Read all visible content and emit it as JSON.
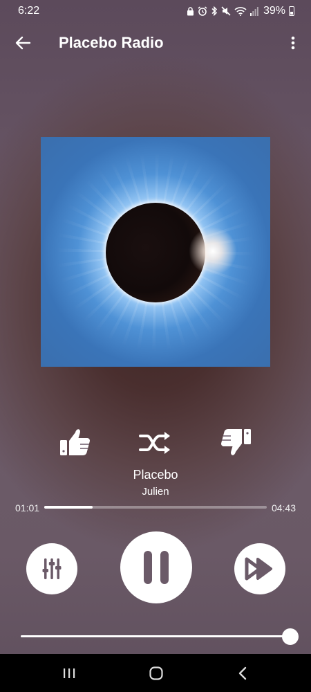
{
  "status_bar": {
    "time": "6:22",
    "battery": "39%",
    "icons": [
      "lock-icon",
      "alarm-icon",
      "bluetooth-icon",
      "mute-icon",
      "wifi-icon",
      "signal-icon",
      "battery-icon"
    ]
  },
  "app_bar": {
    "title": "Placebo Radio",
    "back_icon": "arrow-left-icon",
    "menu_icon": "more-vertical-icon"
  },
  "player": {
    "album_art": "solar-eclipse-album-art",
    "track_title": "Placebo",
    "track_artist": "Julien",
    "time_current": "01:01",
    "time_total": "04:43",
    "progress_fraction": 0.216,
    "volume_fraction": 1.0,
    "rating_icons": [
      "thumbs-up-icon",
      "shuffle-icon",
      "thumbs-down-icon"
    ],
    "controls": [
      "equalizer-icon",
      "pause-icon",
      "skip-next-icon"
    ]
  },
  "nav_bar": {
    "icons": [
      "recents-icon",
      "home-icon",
      "back-icon"
    ]
  },
  "colors": {
    "accent": "#ffffff",
    "control_icon": "#6b5a68",
    "nav_background": "#000000"
  }
}
